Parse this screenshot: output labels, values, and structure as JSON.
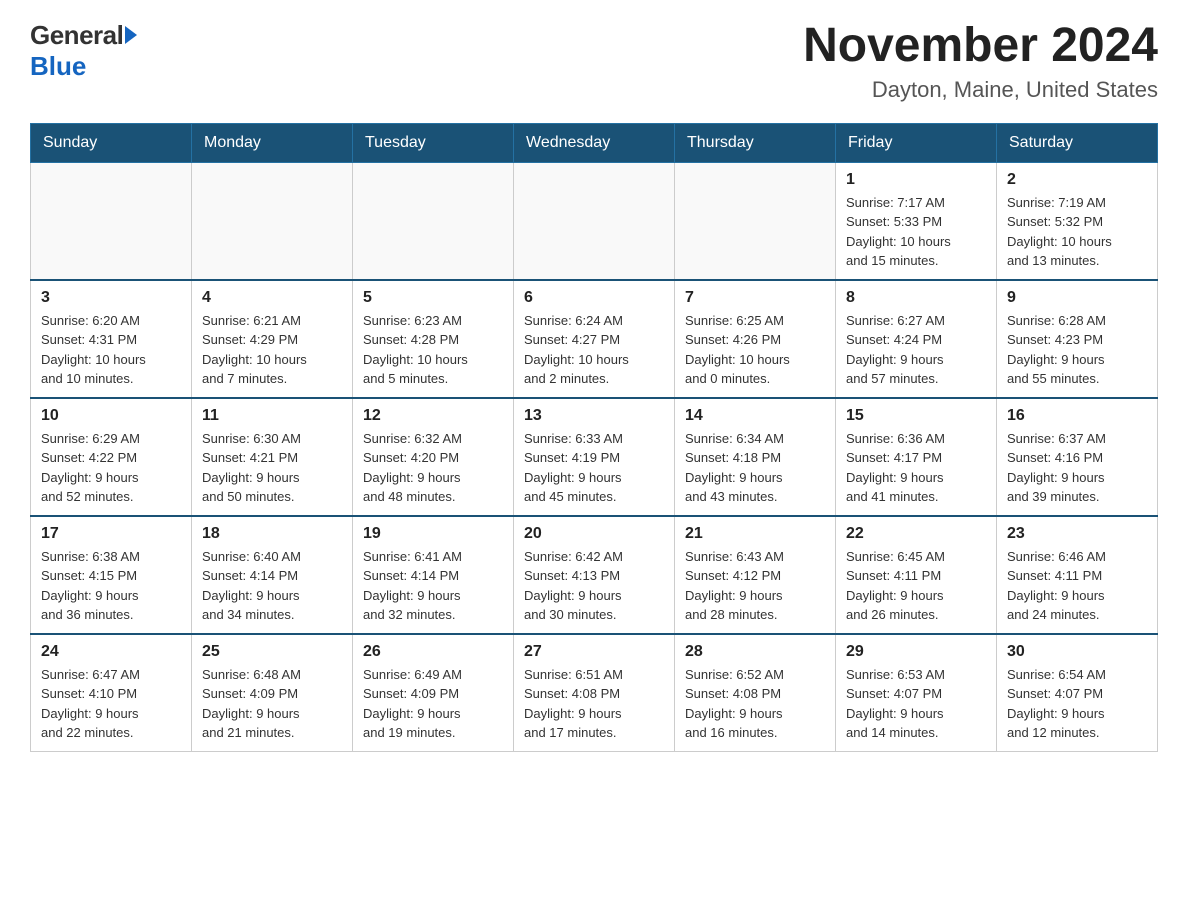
{
  "logo": {
    "general": "General",
    "blue": "Blue"
  },
  "title": "November 2024",
  "location": "Dayton, Maine, United States",
  "days_of_week": [
    "Sunday",
    "Monday",
    "Tuesday",
    "Wednesday",
    "Thursday",
    "Friday",
    "Saturday"
  ],
  "weeks": [
    [
      {
        "day": "",
        "info": ""
      },
      {
        "day": "",
        "info": ""
      },
      {
        "day": "",
        "info": ""
      },
      {
        "day": "",
        "info": ""
      },
      {
        "day": "",
        "info": ""
      },
      {
        "day": "1",
        "info": "Sunrise: 7:17 AM\nSunset: 5:33 PM\nDaylight: 10 hours\nand 15 minutes."
      },
      {
        "day": "2",
        "info": "Sunrise: 7:19 AM\nSunset: 5:32 PM\nDaylight: 10 hours\nand 13 minutes."
      }
    ],
    [
      {
        "day": "3",
        "info": "Sunrise: 6:20 AM\nSunset: 4:31 PM\nDaylight: 10 hours\nand 10 minutes."
      },
      {
        "day": "4",
        "info": "Sunrise: 6:21 AM\nSunset: 4:29 PM\nDaylight: 10 hours\nand 7 minutes."
      },
      {
        "day": "5",
        "info": "Sunrise: 6:23 AM\nSunset: 4:28 PM\nDaylight: 10 hours\nand 5 minutes."
      },
      {
        "day": "6",
        "info": "Sunrise: 6:24 AM\nSunset: 4:27 PM\nDaylight: 10 hours\nand 2 minutes."
      },
      {
        "day": "7",
        "info": "Sunrise: 6:25 AM\nSunset: 4:26 PM\nDaylight: 10 hours\nand 0 minutes."
      },
      {
        "day": "8",
        "info": "Sunrise: 6:27 AM\nSunset: 4:24 PM\nDaylight: 9 hours\nand 57 minutes."
      },
      {
        "day": "9",
        "info": "Sunrise: 6:28 AM\nSunset: 4:23 PM\nDaylight: 9 hours\nand 55 minutes."
      }
    ],
    [
      {
        "day": "10",
        "info": "Sunrise: 6:29 AM\nSunset: 4:22 PM\nDaylight: 9 hours\nand 52 minutes."
      },
      {
        "day": "11",
        "info": "Sunrise: 6:30 AM\nSunset: 4:21 PM\nDaylight: 9 hours\nand 50 minutes."
      },
      {
        "day": "12",
        "info": "Sunrise: 6:32 AM\nSunset: 4:20 PM\nDaylight: 9 hours\nand 48 minutes."
      },
      {
        "day": "13",
        "info": "Sunrise: 6:33 AM\nSunset: 4:19 PM\nDaylight: 9 hours\nand 45 minutes."
      },
      {
        "day": "14",
        "info": "Sunrise: 6:34 AM\nSunset: 4:18 PM\nDaylight: 9 hours\nand 43 minutes."
      },
      {
        "day": "15",
        "info": "Sunrise: 6:36 AM\nSunset: 4:17 PM\nDaylight: 9 hours\nand 41 minutes."
      },
      {
        "day": "16",
        "info": "Sunrise: 6:37 AM\nSunset: 4:16 PM\nDaylight: 9 hours\nand 39 minutes."
      }
    ],
    [
      {
        "day": "17",
        "info": "Sunrise: 6:38 AM\nSunset: 4:15 PM\nDaylight: 9 hours\nand 36 minutes."
      },
      {
        "day": "18",
        "info": "Sunrise: 6:40 AM\nSunset: 4:14 PM\nDaylight: 9 hours\nand 34 minutes."
      },
      {
        "day": "19",
        "info": "Sunrise: 6:41 AM\nSunset: 4:14 PM\nDaylight: 9 hours\nand 32 minutes."
      },
      {
        "day": "20",
        "info": "Sunrise: 6:42 AM\nSunset: 4:13 PM\nDaylight: 9 hours\nand 30 minutes."
      },
      {
        "day": "21",
        "info": "Sunrise: 6:43 AM\nSunset: 4:12 PM\nDaylight: 9 hours\nand 28 minutes."
      },
      {
        "day": "22",
        "info": "Sunrise: 6:45 AM\nSunset: 4:11 PM\nDaylight: 9 hours\nand 26 minutes."
      },
      {
        "day": "23",
        "info": "Sunrise: 6:46 AM\nSunset: 4:11 PM\nDaylight: 9 hours\nand 24 minutes."
      }
    ],
    [
      {
        "day": "24",
        "info": "Sunrise: 6:47 AM\nSunset: 4:10 PM\nDaylight: 9 hours\nand 22 minutes."
      },
      {
        "day": "25",
        "info": "Sunrise: 6:48 AM\nSunset: 4:09 PM\nDaylight: 9 hours\nand 21 minutes."
      },
      {
        "day": "26",
        "info": "Sunrise: 6:49 AM\nSunset: 4:09 PM\nDaylight: 9 hours\nand 19 minutes."
      },
      {
        "day": "27",
        "info": "Sunrise: 6:51 AM\nSunset: 4:08 PM\nDaylight: 9 hours\nand 17 minutes."
      },
      {
        "day": "28",
        "info": "Sunrise: 6:52 AM\nSunset: 4:08 PM\nDaylight: 9 hours\nand 16 minutes."
      },
      {
        "day": "29",
        "info": "Sunrise: 6:53 AM\nSunset: 4:07 PM\nDaylight: 9 hours\nand 14 minutes."
      },
      {
        "day": "30",
        "info": "Sunrise: 6:54 AM\nSunset: 4:07 PM\nDaylight: 9 hours\nand 12 minutes."
      }
    ]
  ]
}
